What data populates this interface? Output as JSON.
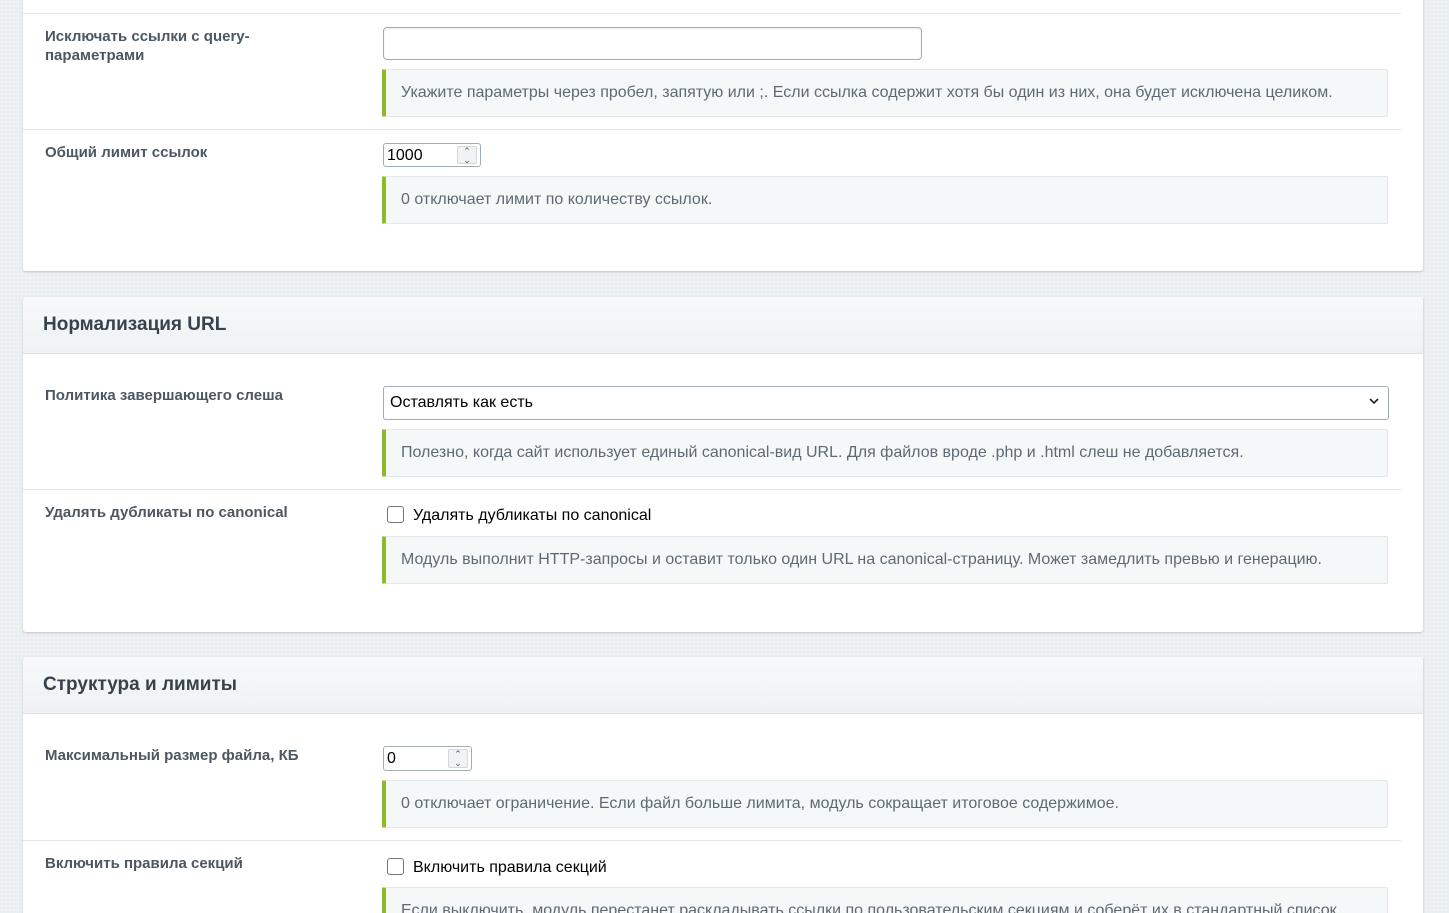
{
  "section_links": {
    "exclude_query": {
      "label": "Исключать ссылки с query-параметрами",
      "value": "",
      "hint": "Укажите параметры через пробел, запятую или ;. Если ссылка содержит хотя бы один из них, она будет исключена целиком."
    },
    "link_limit": {
      "label": "Общий лимит ссылок",
      "value": "1000",
      "hint": "0 отключает лимит по количеству ссылок."
    }
  },
  "section_url_normalization": {
    "title": "Нормализация URL",
    "trailing_slash": {
      "label": "Политика завершающего слеша",
      "selected": "Оставлять как есть",
      "hint": "Полезно, когда сайт использует единый canonical-вид URL. Для файлов вроде .php и .html слеш не добавляется."
    },
    "canonical_dedupe": {
      "label": "Удалять дубликаты по canonical",
      "checkbox_label": "Удалять дубликаты по canonical",
      "checked": false,
      "hint": "Модуль выполнит HTTP-запросы и оставит только один URL на canonical-страницу. Может замедлить превью и генерацию."
    }
  },
  "section_structure": {
    "title": "Структура и лимиты",
    "max_file_size": {
      "label": "Максимальный размер файла, КБ",
      "value": "0",
      "hint": "0 отключает ограничение. Если файл больше лимита, модуль сокращает итоговое содержимое."
    },
    "section_rules": {
      "label": "Включить правила секций",
      "checkbox_label": "Включить правила секций",
      "checked": false,
      "hint": "Если выключить, модуль перестанет раскладывать ссылки по пользовательским секциям и соберёт их в стандартный список."
    }
  },
  "colors": {
    "page_bg": "#e9eef0",
    "hint_accent": "#8bbb25",
    "label_text": "#4b5761"
  }
}
